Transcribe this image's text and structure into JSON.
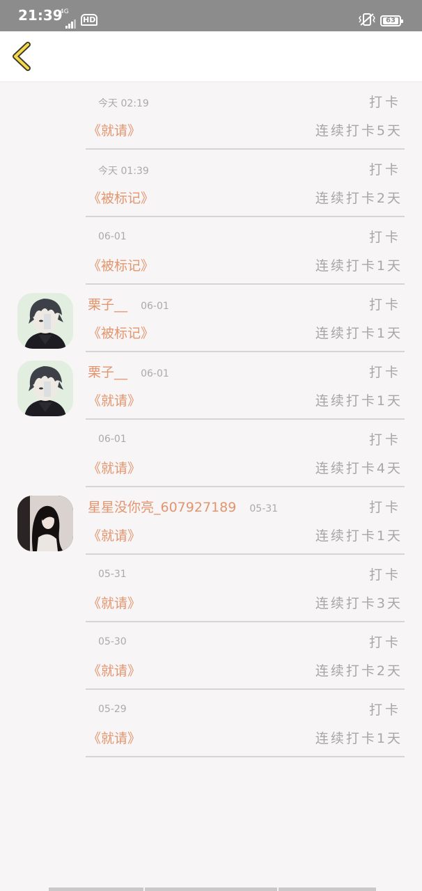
{
  "status_bar": {
    "time": "21:39",
    "network": "4G",
    "hd": "HD",
    "battery": "63"
  },
  "header": {
    "back_icon": "chevron-left-icon",
    "accent_color": "#f5d84c"
  },
  "colors": {
    "accent_text": "#e3956d",
    "muted_text": "#a6a6a6"
  },
  "records": [
    {
      "avatar": null,
      "name": "",
      "date": "今天 02:19",
      "action": "打卡",
      "book": "《就请》",
      "streak": "连续打卡5天"
    },
    {
      "avatar": null,
      "name": "",
      "date": "今天 01:39",
      "action": "打卡",
      "book": "《被标记》",
      "streak": "连续打卡2天"
    },
    {
      "avatar": null,
      "name": "",
      "date": "06-01",
      "action": "打卡",
      "book": "《被标记》",
      "streak": "连续打卡1天"
    },
    {
      "avatar": "boy",
      "name": "栗子__",
      "date": "06-01",
      "action": "打卡",
      "book": "《被标记》",
      "streak": "连续打卡1天"
    },
    {
      "avatar": "boy",
      "name": "栗子__",
      "date": "06-01",
      "action": "打卡",
      "book": "《就请》",
      "streak": "连续打卡1天"
    },
    {
      "avatar": null,
      "name": "",
      "date": "06-01",
      "action": "打卡",
      "book": "《就请》",
      "streak": "连续打卡4天"
    },
    {
      "avatar": "girl",
      "name": "星星没你亮_607927189",
      "date": "05-31",
      "action": "打卡",
      "book": "《就请》",
      "streak": "连续打卡1天"
    },
    {
      "avatar": null,
      "name": "",
      "date": "05-31",
      "action": "打卡",
      "book": "《就请》",
      "streak": "连续打卡3天"
    },
    {
      "avatar": null,
      "name": "",
      "date": "05-30",
      "action": "打卡",
      "book": "《就请》",
      "streak": "连续打卡2天"
    },
    {
      "avatar": null,
      "name": "",
      "date": "05-29",
      "action": "打卡",
      "book": "《就请》",
      "streak": "连续打卡1天"
    }
  ]
}
